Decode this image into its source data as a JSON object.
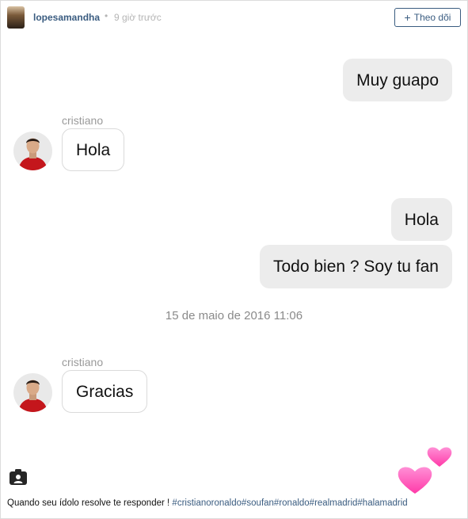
{
  "header": {
    "username": "lopesamandha",
    "separator": "•",
    "time_ago": "9 giờ trước",
    "follow_label": "Theo dõi"
  },
  "chat": {
    "messages": [
      {
        "side": "out",
        "text": "Muy guapo"
      },
      {
        "side": "in",
        "sender": "cristiano",
        "text": "Hola"
      },
      {
        "side": "out",
        "text": "Hola"
      },
      {
        "side": "out",
        "text": "Todo bien ? Soy tu fan"
      },
      {
        "side": "in",
        "sender": "cristiano",
        "text": "Gracias"
      }
    ],
    "timestamp": "15 de maio de 2016 11:06"
  },
  "caption": {
    "text": "Quando seu ídolo resolve te responder !",
    "hashtags": "#cristianoronaldo#soufan#ronaldo#realmadrid#halamadrid"
  },
  "colors": {
    "link": "#3a5c80",
    "outgoing_bubble": "#ececec",
    "heart": "#ff4fb8"
  }
}
